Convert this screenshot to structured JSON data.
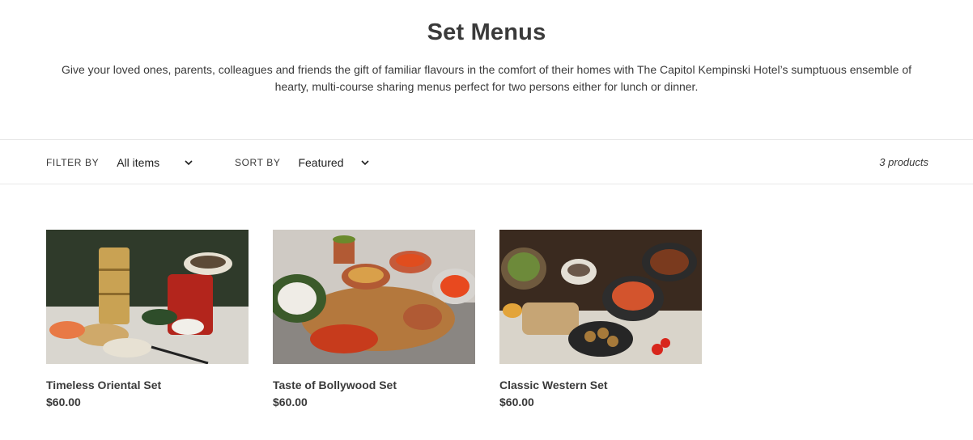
{
  "header": {
    "title": "Set Menus",
    "description": "Give your loved ones, parents, colleagues and friends the gift of familiar flavours in the comfort of their homes with The Capitol Kempinski Hotel’s sumptuous ensemble of hearty, multi-course sharing menus perfect for two persons either for lunch or dinner."
  },
  "toolbar": {
    "filter_label": "FILTER BY",
    "filter_value": "All items",
    "sort_label": "SORT BY",
    "sort_value": "Featured",
    "product_count": "3 products"
  },
  "products": [
    {
      "name": "Timeless Oriental Set",
      "price": "$60.00",
      "image_icon": "oriental-food-photo"
    },
    {
      "name": "Taste of Bollywood Set",
      "price": "$60.00",
      "image_icon": "indian-food-photo"
    },
    {
      "name": "Classic Western Set",
      "price": "$60.00",
      "image_icon": "western-food-photo"
    }
  ],
  "colors": {
    "text": "#3a3a3a",
    "border": "#e8e8e8",
    "background": "#ffffff"
  }
}
